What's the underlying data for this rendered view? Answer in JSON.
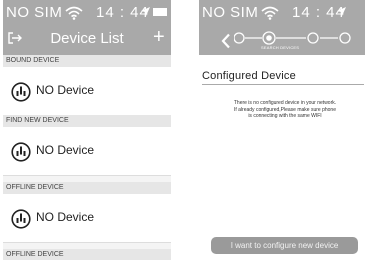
{
  "left_screen": {
    "status": {
      "carrier": "NO SIM",
      "time": "14 : 44"
    },
    "header": {
      "title": "Device List",
      "add_label": "+"
    },
    "sections": [
      {
        "header": "BOUND DEVICE",
        "item": "NO Device"
      },
      {
        "header": "FIND NEW DEVICE",
        "item": "NO Device"
      },
      {
        "header": "OFFLINE DEVICE",
        "item": "NO Device"
      },
      {
        "header": "OFFLINE DEVICE"
      }
    ]
  },
  "right_screen": {
    "status": {
      "carrier": "NO SIM",
      "time": "14 : 44"
    },
    "stepper": {
      "caption": "SEARCH DEVICES"
    },
    "title": "Configured Device",
    "message_lines": [
      "There is no configured device in your network.",
      "If already configured,Please make sure phone",
      "is connecting with the same WIFI"
    ],
    "button_label": "I want to configure new device"
  },
  "colors": {
    "header_bg": "#a9a9a9",
    "section_bg": "#e6e6e6",
    "button_bg": "#9a9a9a"
  }
}
